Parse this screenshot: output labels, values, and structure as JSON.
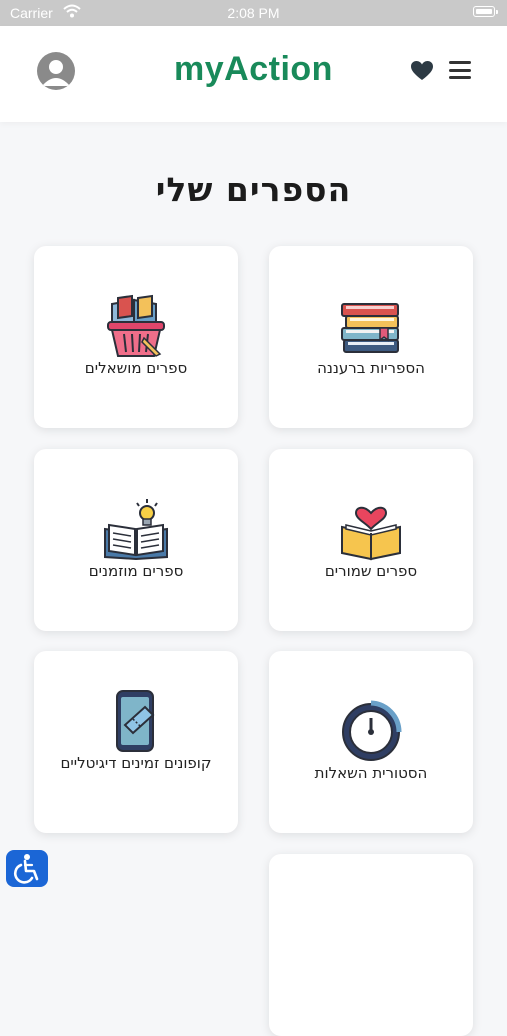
{
  "status": {
    "carrier": "Carrier",
    "time": "2:08 PM"
  },
  "header": {
    "logo": "myAction"
  },
  "page": {
    "title": "הספרים שלי"
  },
  "cards": [
    {
      "label": "הספריות ברעננה",
      "icon": "stacked-books-icon"
    },
    {
      "label": "ספרים מושאלים",
      "icon": "book-basket-icon"
    },
    {
      "label": "ספרים שמורים",
      "icon": "heart-book-icon"
    },
    {
      "label": "ספרים מוזמנים",
      "icon": "idea-book-icon"
    },
    {
      "label": "הסטורית השאלות",
      "icon": "history-clock-icon"
    },
    {
      "label": "קופונים זמינים דיגיטליים",
      "icon": "phone-coupon-icon"
    }
  ],
  "colors": {
    "brand": "#198a5a",
    "accessibility": "#1b66d6"
  }
}
